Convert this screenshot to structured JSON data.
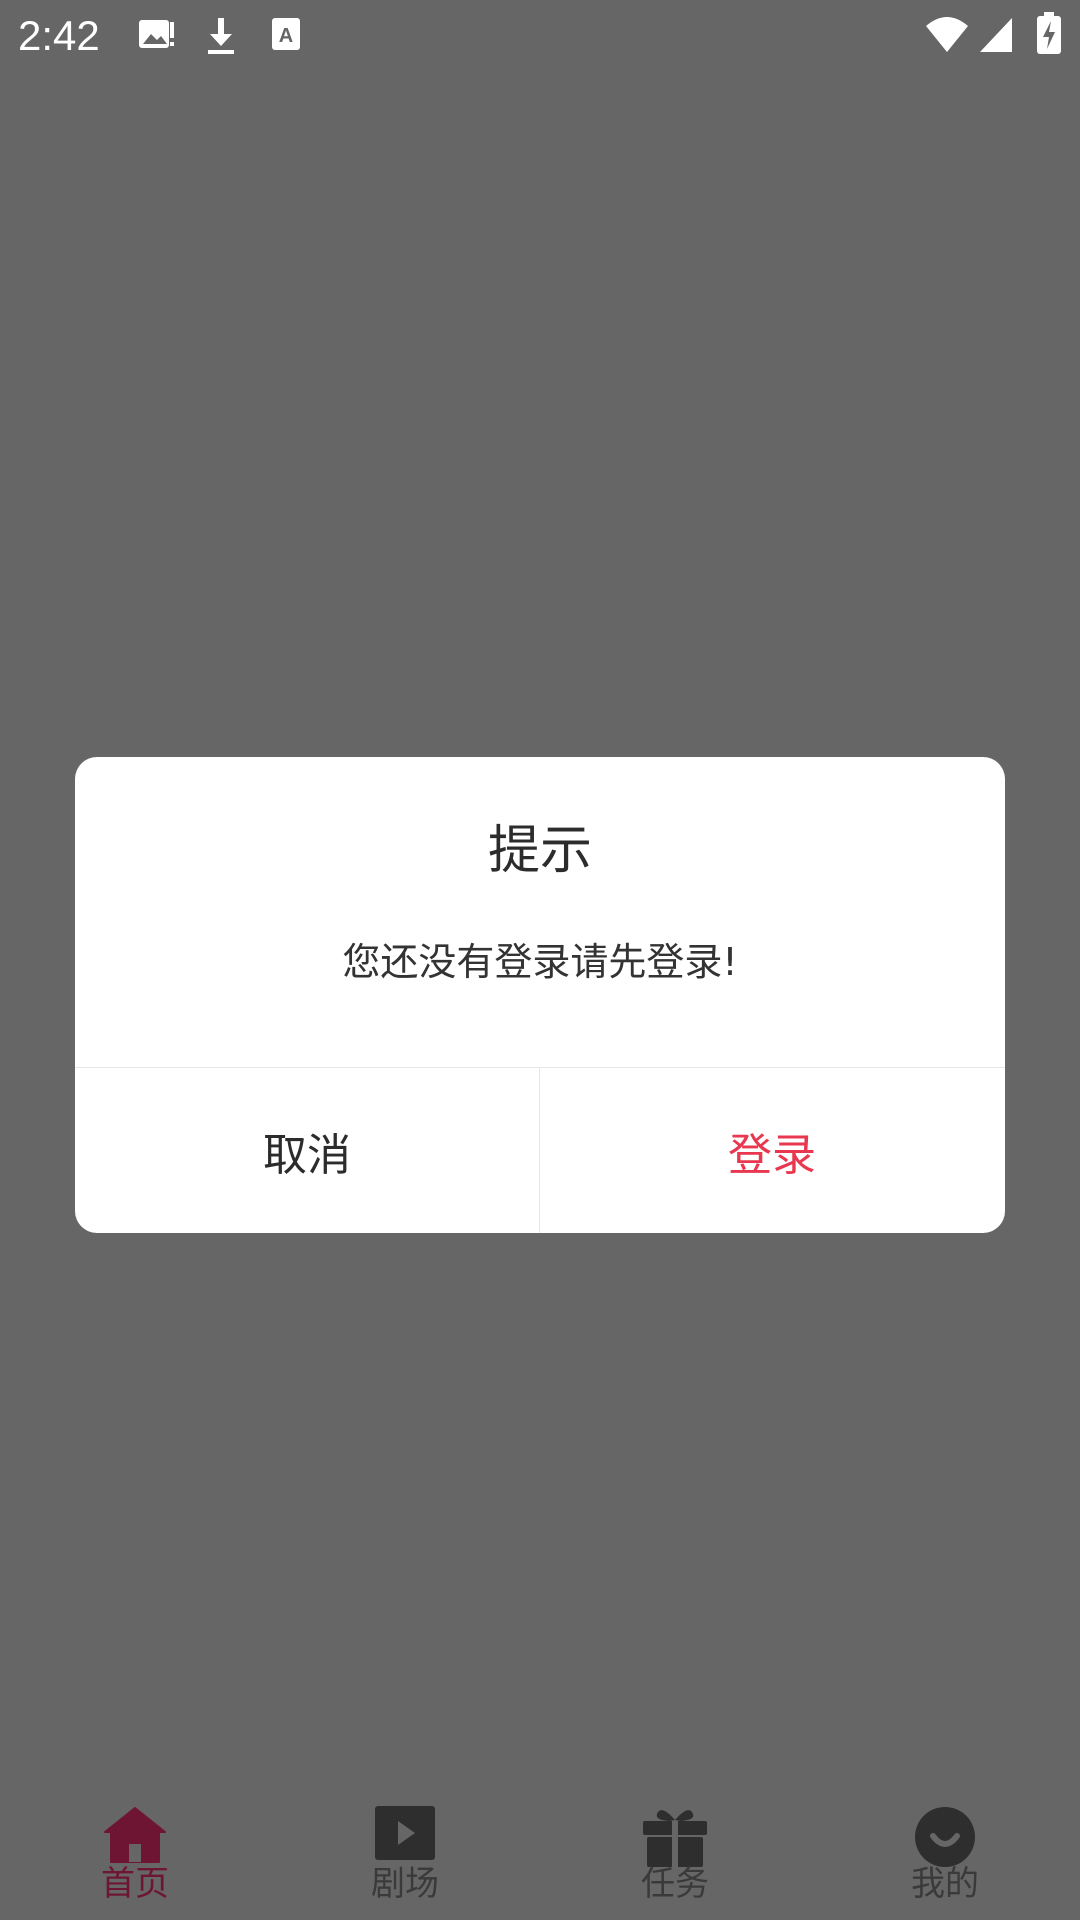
{
  "status_bar": {
    "time": "2:42",
    "icons": [
      "image-icon",
      "download-icon",
      "text-icon",
      "wifi-icon",
      "signal-icon",
      "battery-charging-icon"
    ]
  },
  "dialog": {
    "title": "提示",
    "message": "您还没有登录请先登录!",
    "cancel_label": "取消",
    "confirm_label": "登录",
    "confirm_color": "#e8374f"
  },
  "bottom_nav": {
    "items": [
      {
        "label": "首页",
        "icon": "home-icon",
        "active": true
      },
      {
        "label": "剧场",
        "icon": "play-icon",
        "active": false
      },
      {
        "label": "任务",
        "icon": "gift-icon",
        "active": false
      },
      {
        "label": "我的",
        "icon": "smiley-icon",
        "active": false
      }
    ],
    "active_color": "#6f1534"
  }
}
